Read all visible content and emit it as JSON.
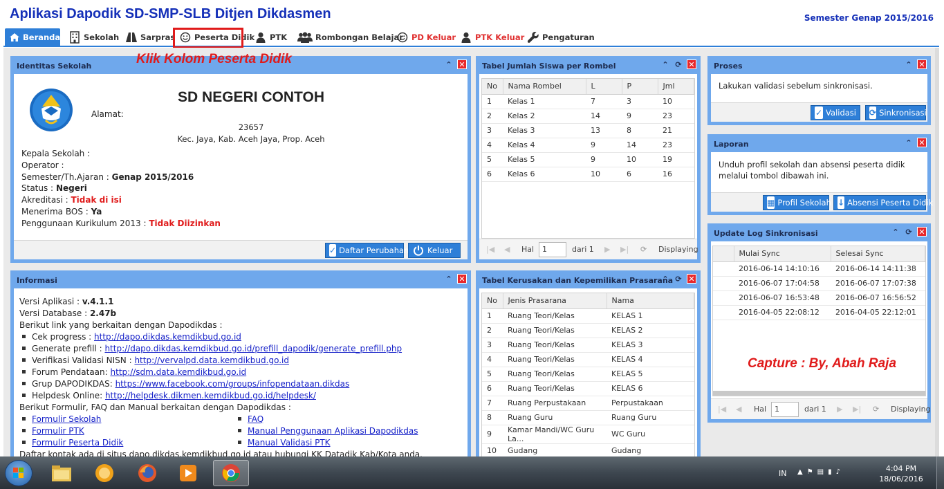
{
  "app": {
    "title": "Aplikasi Dapodik SD-SMP-SLB Ditjen Dikdasmen",
    "semester": "Semester Genap 2015/2016"
  },
  "nav": [
    {
      "label": "Beranda",
      "icon": "home-icon"
    },
    {
      "label": "Sekolah",
      "icon": "building-icon"
    },
    {
      "label": "Sarpras",
      "icon": "road-icon"
    },
    {
      "label": "Peserta Didik",
      "icon": "smiley-icon"
    },
    {
      "label": "PTK",
      "icon": "user-icon"
    },
    {
      "label": "Rombongan Belajar",
      "icon": "group-icon"
    },
    {
      "label": "PD Keluar",
      "icon": "smiley-icon"
    },
    {
      "label": "PTK Keluar",
      "icon": "user-icon"
    },
    {
      "label": "Pengaturan",
      "icon": "wrench-icon"
    }
  ],
  "annotations": {
    "klik": "Klik Kolom Peserta Didik",
    "capture": "Capture : By, Abah Raja"
  },
  "identitas": {
    "title": "Identitas Sekolah",
    "school_name": "SD NEGERI CONTOH",
    "alamat_label": "Alamat:",
    "kode_pos": "23657",
    "region": "Kec. Jaya, Kab. Aceh Jaya, Prop. Aceh",
    "kepala_label": "Kepala Sekolah :",
    "operator_label": "Operator :",
    "semester_label": "Semester/Th.Ajaran :",
    "semester_value": "Genap 2015/2016",
    "status_label": "Status :",
    "status_value": "Negeri",
    "akreditasi_label": "Akreditasi :",
    "akreditasi_value": "Tidak di isi",
    "bos_label": "Menerima BOS :",
    "bos_value": "Ya",
    "kurikulum_label": "Penggunaan Kurikulum 2013 :",
    "kurikulum_value": "Tidak Diizinkan",
    "btn_perubahan": "Daftar Perubahan",
    "btn_keluar": "Keluar"
  },
  "informasi": {
    "title": "Informasi",
    "versi_app_label": "Versi Aplikasi :",
    "versi_app": "v.4.1.1",
    "versi_db_label": "Versi Database :",
    "versi_db": "2.47b",
    "links_intro": "Berikut link yang berkaitan dengan Dapodikdas :",
    "links": [
      {
        "label": "Cek progress :",
        "url": "http://dapo.dikdas.kemdikbud.go.id"
      },
      {
        "label": "Generate prefill :",
        "url": "http://dapo.dikdas.kemdikbud.go.id/prefill_dapodik/generate_prefill.php"
      },
      {
        "label": "Verifikasi Validasi NISN :",
        "url": "http://vervalpd.data.kemdikbud.go.id"
      },
      {
        "label": "Forum Pendataan:",
        "url": "http://sdm.data.kemdikbud.go.id"
      },
      {
        "label": "Grup DAPODIKDAS:",
        "url": "https://www.facebook.com/groups/infopendataan.dikdas"
      },
      {
        "label": "Helpdesk Online:",
        "url": "http://helpdesk.dikmen.kemdikbud.go.id/helpdesk/"
      }
    ],
    "forms_intro": "Berikut Formulir, FAQ dan Manual berkaitan dengan Dapodikdas :",
    "forms_left": [
      "Formulir Sekolah",
      "Formulir PTK",
      "Formulir Peserta Didik"
    ],
    "forms_right": [
      "FAQ",
      "Manual Penggunaan Aplikasi Dapodikdas",
      "Manual Validasi PTK"
    ],
    "footer_text": "Daftar kontak ada di situs dapo.dikdas.kemdikbud.go.id atau hubungi KK Datadik Kab/Kota anda."
  },
  "rombel": {
    "title": "Tabel Jumlah Siswa per Rombel",
    "headers": [
      "No",
      "Nama Rombel",
      "L",
      "P",
      "Jml"
    ],
    "rows": [
      [
        "1",
        "Kelas 1",
        "7",
        "3",
        "10"
      ],
      [
        "2",
        "Kelas 2",
        "14",
        "9",
        "23"
      ],
      [
        "3",
        "Kelas 3",
        "13",
        "8",
        "21"
      ],
      [
        "4",
        "Kelas 4",
        "9",
        "14",
        "23"
      ],
      [
        "5",
        "Kelas 5",
        "9",
        "10",
        "19"
      ],
      [
        "6",
        "Kelas 6",
        "10",
        "6",
        "16"
      ]
    ],
    "pager": {
      "hal": "Hal",
      "page": "1",
      "of": "dari 1",
      "displaying": "Displaying"
    }
  },
  "prasarana": {
    "title": "Tabel Kerusakan dan Kepemilikan Prasarana",
    "headers": [
      "No",
      "Jenis Prasarana",
      "Nama"
    ],
    "rows": [
      [
        "1",
        "Ruang Teori/Kelas",
        "KELAS 1"
      ],
      [
        "2",
        "Ruang Teori/Kelas",
        "KELAS 2"
      ],
      [
        "3",
        "Ruang Teori/Kelas",
        "KELAS 3"
      ],
      [
        "4",
        "Ruang Teori/Kelas",
        "KELAS 4"
      ],
      [
        "5",
        "Ruang Teori/Kelas",
        "KELAS 5"
      ],
      [
        "6",
        "Ruang Teori/Kelas",
        "KELAS 6"
      ],
      [
        "7",
        "Ruang Perpustakaan",
        "Perpustakaan"
      ],
      [
        "8",
        "Ruang Guru",
        "Ruang Guru"
      ],
      [
        "9",
        "Kamar Mandi/WC Guru La...",
        "WC Guru"
      ],
      [
        "10",
        "Gudang",
        "Gudang"
      ]
    ]
  },
  "proses": {
    "title": "Proses",
    "text": "Lakukan validasi sebelum sinkronisasi.",
    "btn_validasi": "Validasi",
    "btn_sinkron": "Sinkronisasi"
  },
  "laporan": {
    "title": "Laporan",
    "text": "Unduh profil sekolah dan absensi peserta didik melalui tombol dibawah ini.",
    "btn_profil": "Profil Sekolah",
    "btn_absensi": "Absensi Peserta Didik"
  },
  "synclog": {
    "title": "Update Log Sinkronisasi",
    "headers": [
      "Mulai Sync",
      "Selesai Sync"
    ],
    "rows": [
      [
        "2016-06-14 14:10:16",
        "2016-06-14 14:11:38"
      ],
      [
        "2016-06-07 17:04:58",
        "2016-06-07 17:07:38"
      ],
      [
        "2016-06-07 16:53:48",
        "2016-06-07 16:56:52"
      ],
      [
        "2016-04-05 22:08:12",
        "2016-04-05 22:12:01"
      ]
    ],
    "pager": {
      "hal": "Hal",
      "page": "1",
      "of": "dari 1",
      "displaying": "Displaying"
    }
  },
  "taskbar": {
    "lang": "IN",
    "time": "4:04 PM",
    "date": "18/06/2016"
  }
}
